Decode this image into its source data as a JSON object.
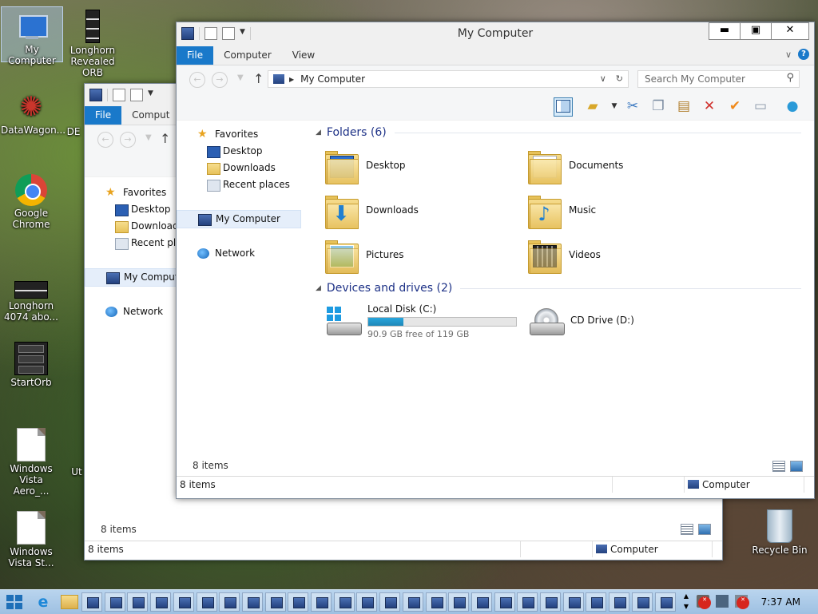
{
  "desktop": {
    "icons": [
      {
        "label": "My Computer"
      },
      {
        "label": "Longhorn Revealed ORB"
      },
      {
        "label": "DataWagon..."
      },
      {
        "label": "DE"
      },
      {
        "label": "Google Chrome"
      },
      {
        "label": "Longhorn 4074 abo..."
      },
      {
        "label": "StartOrb"
      },
      {
        "label": "Windows Vista Aero_..."
      },
      {
        "label": "Ut"
      },
      {
        "label": "Windows Vista St..."
      },
      {
        "label": "Recycle Bin"
      }
    ]
  },
  "front_window": {
    "title": "My Computer",
    "caption": {
      "minimize": "▬",
      "maximize": "▣",
      "close": "✕"
    },
    "tabs": [
      {
        "label": "File"
      },
      {
        "label": "Computer"
      },
      {
        "label": "View"
      }
    ],
    "address": {
      "crumb": "My Computer"
    },
    "search": {
      "placeholder": "Search My Computer"
    },
    "nav": {
      "favorites": "Favorites",
      "desktop": "Desktop",
      "downloads": "Downloads",
      "recent": "Recent places",
      "computer": "My Computer",
      "network": "Network"
    },
    "folders_header": "Folders (6)",
    "folders": [
      {
        "label": "Desktop"
      },
      {
        "label": "Documents"
      },
      {
        "label": "Downloads"
      },
      {
        "label": "Music"
      },
      {
        "label": "Pictures"
      },
      {
        "label": "Videos"
      }
    ],
    "drives_header": "Devices and drives (2)",
    "drives": [
      {
        "label": "Local Disk (C:)",
        "free": "90.9 GB free of 119 GB",
        "used_fraction": 0.236
      },
      {
        "label": "CD Drive (D:)"
      }
    ],
    "status_count": "8 items",
    "statusbar": {
      "count": "8 items",
      "location": "Computer"
    }
  },
  "back_window": {
    "tabs": [
      {
        "label": "File"
      },
      {
        "label": "Comput"
      }
    ],
    "nav": {
      "favorites": "Favorites",
      "desktop": "Desktop",
      "downloads": "Downloads",
      "recent": "Recent plac",
      "computer": "My Compute",
      "network": "Network"
    },
    "status_count": "8 items",
    "statusbar": {
      "count": "8 items",
      "location": "Computer"
    }
  },
  "taskbar": {
    "clock": "7:37 AM",
    "pinned_windows": 26
  },
  "colors": {
    "accent": "#1979ca",
    "group_header": "#1e3287",
    "drive_bar": "#28a6dd"
  }
}
